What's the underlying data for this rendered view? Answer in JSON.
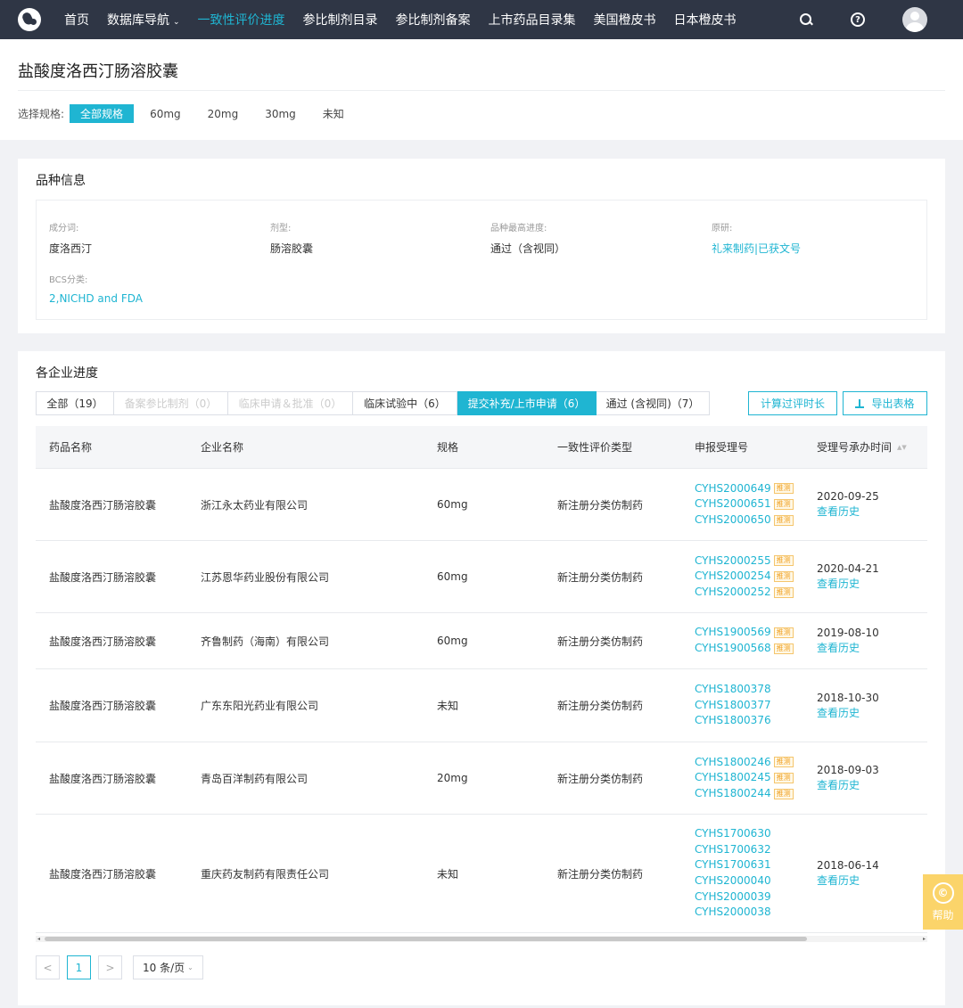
{
  "nav": {
    "items": [
      {
        "label": "首页",
        "active": false
      },
      {
        "label": "数据库导航",
        "active": false,
        "dropdown": true
      },
      {
        "label": "一致性评价进度",
        "active": true
      },
      {
        "label": "参比制剂目录",
        "active": false
      },
      {
        "label": "参比制剂备案",
        "active": false
      },
      {
        "label": "上市药品目录集",
        "active": false
      },
      {
        "label": "美国橙皮书",
        "active": false
      },
      {
        "label": "日本橙皮书",
        "active": false
      }
    ],
    "caret": "⌄",
    "help_glyph": "?",
    "icons": [
      "search-icon",
      "help-icon",
      "avatar"
    ]
  },
  "page": {
    "title": "盐酸度洛西汀肠溶胶囊",
    "spec_label": "选择规格:",
    "spec_options": [
      "全部规格",
      "60mg",
      "20mg",
      "30mg",
      "未知"
    ],
    "spec_selected": 0
  },
  "info": {
    "title": "品种信息",
    "fields": [
      {
        "label": "成分词:",
        "value": "度洛西汀",
        "link": false
      },
      {
        "label": "剂型:",
        "value": "肠溶胶囊",
        "link": false
      },
      {
        "label": "品种最高进度:",
        "value": "通过（含视同）",
        "link": false
      },
      {
        "label": "原研:",
        "value": "礼来制药|已获文号",
        "link": true
      },
      {
        "label": "BCS分类:",
        "value": "2,NICHD and FDA",
        "link": true
      }
    ]
  },
  "progress": {
    "title": "各企业进度",
    "tabs": [
      {
        "label": "全部（19）",
        "state": "normal"
      },
      {
        "label": "备案参比制剂（0）",
        "state": "disabled"
      },
      {
        "label": "临床申请＆批准（0）",
        "state": "disabled"
      },
      {
        "label": "临床试验中（6）",
        "state": "normal"
      },
      {
        "label": "提交补充/上市申请（6）",
        "state": "active"
      },
      {
        "label": "通过 (含视同)（7）",
        "state": "normal"
      }
    ],
    "btn_calc": "计算过评时长",
    "btn_export": "导出表格",
    "columns": [
      "药品名称",
      "企业名称",
      "规格",
      "一致性评价类型",
      "申报受理号",
      "受理号承办时间"
    ],
    "sort_glyph": "▲▼",
    "tag_label": "推测",
    "history_label": "查看历史",
    "rows": [
      {
        "drug": "盐酸度洛西汀肠溶胶囊",
        "company": "浙江永太药业有限公司",
        "spec": "60mg",
        "type": "新注册分类仿制药",
        "numbers": [
          {
            "no": "CYHS2000649",
            "tag": true
          },
          {
            "no": "CYHS2000651",
            "tag": true
          },
          {
            "no": "CYHS2000650",
            "tag": true
          }
        ],
        "date": "2020-09-25"
      },
      {
        "drug": "盐酸度洛西汀肠溶胶囊",
        "company": "江苏恩华药业股份有限公司",
        "spec": "60mg",
        "type": "新注册分类仿制药",
        "numbers": [
          {
            "no": "CYHS2000255",
            "tag": true
          },
          {
            "no": "CYHS2000254",
            "tag": true
          },
          {
            "no": "CYHS2000252",
            "tag": true
          }
        ],
        "date": "2020-04-21"
      },
      {
        "drug": "盐酸度洛西汀肠溶胶囊",
        "company": "齐鲁制药（海南）有限公司",
        "spec": "60mg",
        "type": "新注册分类仿制药",
        "numbers": [
          {
            "no": "CYHS1900569",
            "tag": true
          },
          {
            "no": "CYHS1900568",
            "tag": true
          }
        ],
        "date": "2019-08-10"
      },
      {
        "drug": "盐酸度洛西汀肠溶胶囊",
        "company": "广东东阳光药业有限公司",
        "spec": "未知",
        "type": "新注册分类仿制药",
        "numbers": [
          {
            "no": "CYHS1800378",
            "tag": false
          },
          {
            "no": "CYHS1800377",
            "tag": false
          },
          {
            "no": "CYHS1800376",
            "tag": false
          }
        ],
        "date": "2018-10-30"
      },
      {
        "drug": "盐酸度洛西汀肠溶胶囊",
        "company": "青岛百洋制药有限公司",
        "spec": "20mg",
        "type": "新注册分类仿制药",
        "numbers": [
          {
            "no": "CYHS1800246",
            "tag": true
          },
          {
            "no": "CYHS1800245",
            "tag": true
          },
          {
            "no": "CYHS1800244",
            "tag": true
          }
        ],
        "date": "2018-09-03"
      },
      {
        "drug": "盐酸度洛西汀肠溶胶囊",
        "company": "重庆药友制药有限责任公司",
        "spec": "未知",
        "type": "新注册分类仿制药",
        "numbers": [
          {
            "no": "CYHS1700630",
            "tag": false
          },
          {
            "no": "CYHS1700632",
            "tag": false
          },
          {
            "no": "CYHS1700631",
            "tag": false
          },
          {
            "no": "CYHS2000040",
            "tag": false
          },
          {
            "no": "CYHS2000039",
            "tag": false
          },
          {
            "no": "CYHS2000038",
            "tag": false
          }
        ],
        "date": "2018-06-14"
      }
    ]
  },
  "pager": {
    "prev": "<",
    "current": "1",
    "next": ">",
    "page_size": "10 条/页",
    "caret": "⌄"
  },
  "scrollbar": {
    "left": "◂",
    "right": "▸"
  },
  "help_float": {
    "glyph": "©",
    "label": "帮助"
  },
  "colors": {
    "accent": "#1fb5d2",
    "nav_bg": "#2f3645",
    "tag": "#f0a020",
    "help_bg": "#fbd46a"
  }
}
